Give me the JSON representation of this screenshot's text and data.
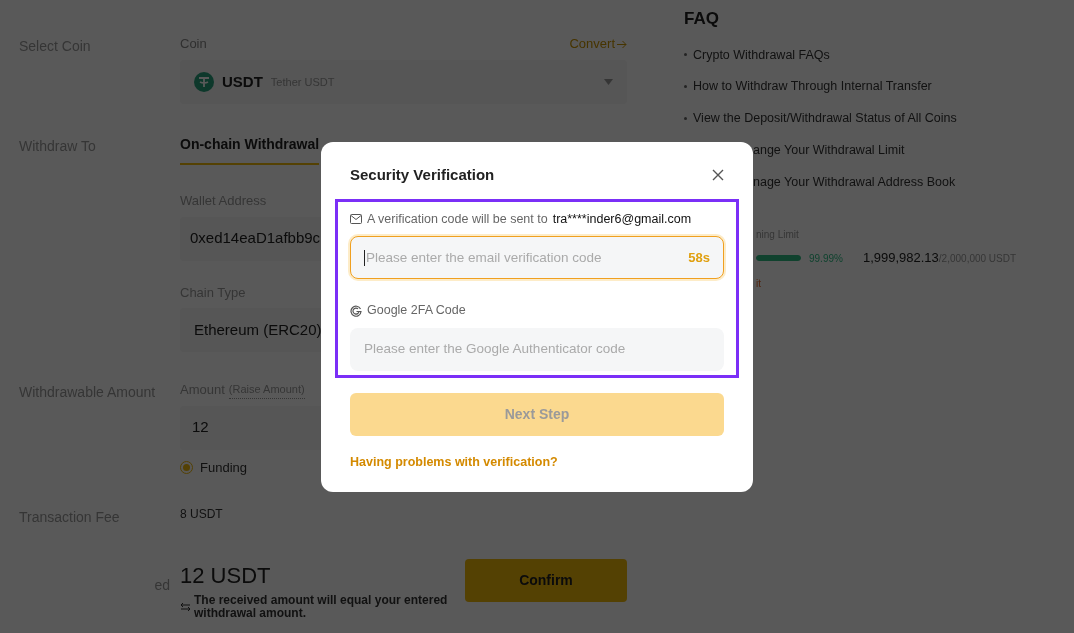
{
  "form": {
    "select_coin": {
      "label": "Select Coin",
      "field_label": "Coin",
      "convert_link": "Convert",
      "coin": "USDT",
      "coin_name": "Tether USDT"
    },
    "withdraw_to": {
      "label": "Withdraw To",
      "tabs": [
        {
          "label": "On-chain Withdrawal",
          "selected": true
        }
      ],
      "wallet_label": "Wallet Address",
      "wallet_value": "0xed14eaD1afbb9c",
      "chain_label": "Chain Type",
      "chain_value": "Ethereum (ERC20)"
    },
    "amount": {
      "label": "Withdrawable Amount",
      "field_label": "Amount",
      "raise_link": "(Raise Amount)",
      "value": "12",
      "accounts": [
        {
          "label": "Funding",
          "selected": true
        }
      ]
    },
    "fee": {
      "label": "Transaction Fee",
      "value": "8 USDT"
    },
    "received": {
      "label": "ed",
      "value": "12 USDT",
      "note": "The received amount will equal your entered withdrawal amount.",
      "confirm_button": "Confirm"
    }
  },
  "faq": {
    "title": "FAQ",
    "items": [
      {
        "text": "Crypto Withdrawal FAQs",
        "bullet": true
      },
      {
        "text": "How to Withdraw Through Internal Transfer",
        "bullet": true
      },
      {
        "text": "View the Deposit/Withdrawal Status of All Coins",
        "bullet": true
      },
      {
        "text": "ange Your Withdrawal Limit",
        "bullet": false
      },
      {
        "text": "nage Your Withdrawal Address Book",
        "bullet": false
      }
    ]
  },
  "limit": {
    "label": "ning Limit",
    "level": 0.9999,
    "percent": "99.99%",
    "used": "1,999,982.13",
    "total": "/2,000,000 USDT",
    "footer": "it"
  },
  "modal": {
    "title": "Security Verification",
    "email_notice": "A verification code will be sent to",
    "email": "tra****inder6@gmail.com",
    "email_input": {
      "placeholder": "Please enter the email verification code",
      "focused": true,
      "countdown": "58s"
    },
    "google_label": "Google 2FA Code",
    "google_input": {
      "placeholder": "Please enter the Google Authenticator code",
      "focused": false
    },
    "next_button": {
      "label": "Next Step",
      "disabled": true
    },
    "help_link": "Having problems with verification?"
  }
}
